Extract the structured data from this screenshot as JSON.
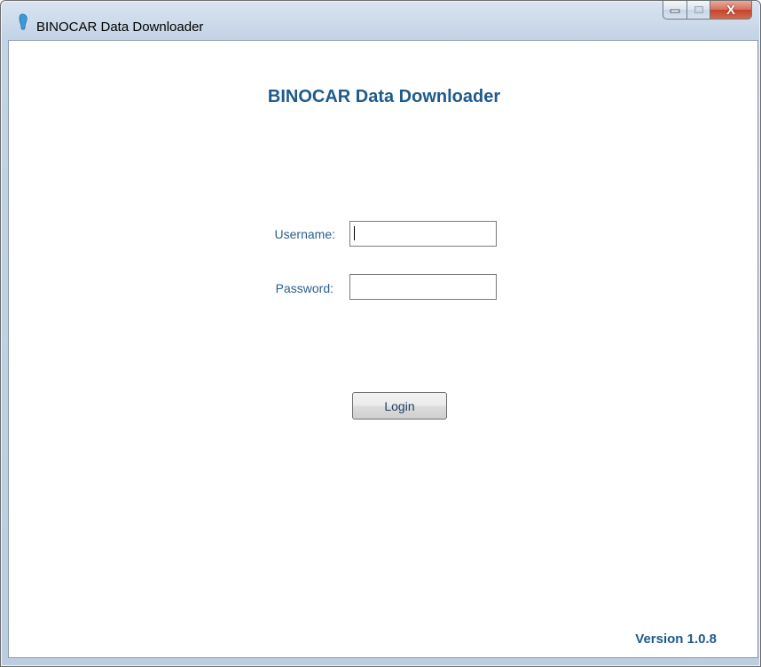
{
  "window": {
    "title": "BINOCAR Data Downloader",
    "close_glyph": "X"
  },
  "main": {
    "heading": "BINOCAR Data Downloader",
    "username_label": "Username:",
    "password_label": "Password:",
    "username_value": "",
    "password_value": "",
    "login_label": "Login",
    "version": "Version 1.0.8"
  },
  "icons": {
    "app": "footprint-icon",
    "minimize": "minimize-icon",
    "maximize": "maximize-icon",
    "close": "close-icon"
  },
  "colors": {
    "accent": "#1f5a8c",
    "label": "#2a5f8f",
    "close_button": "#c4442d"
  }
}
